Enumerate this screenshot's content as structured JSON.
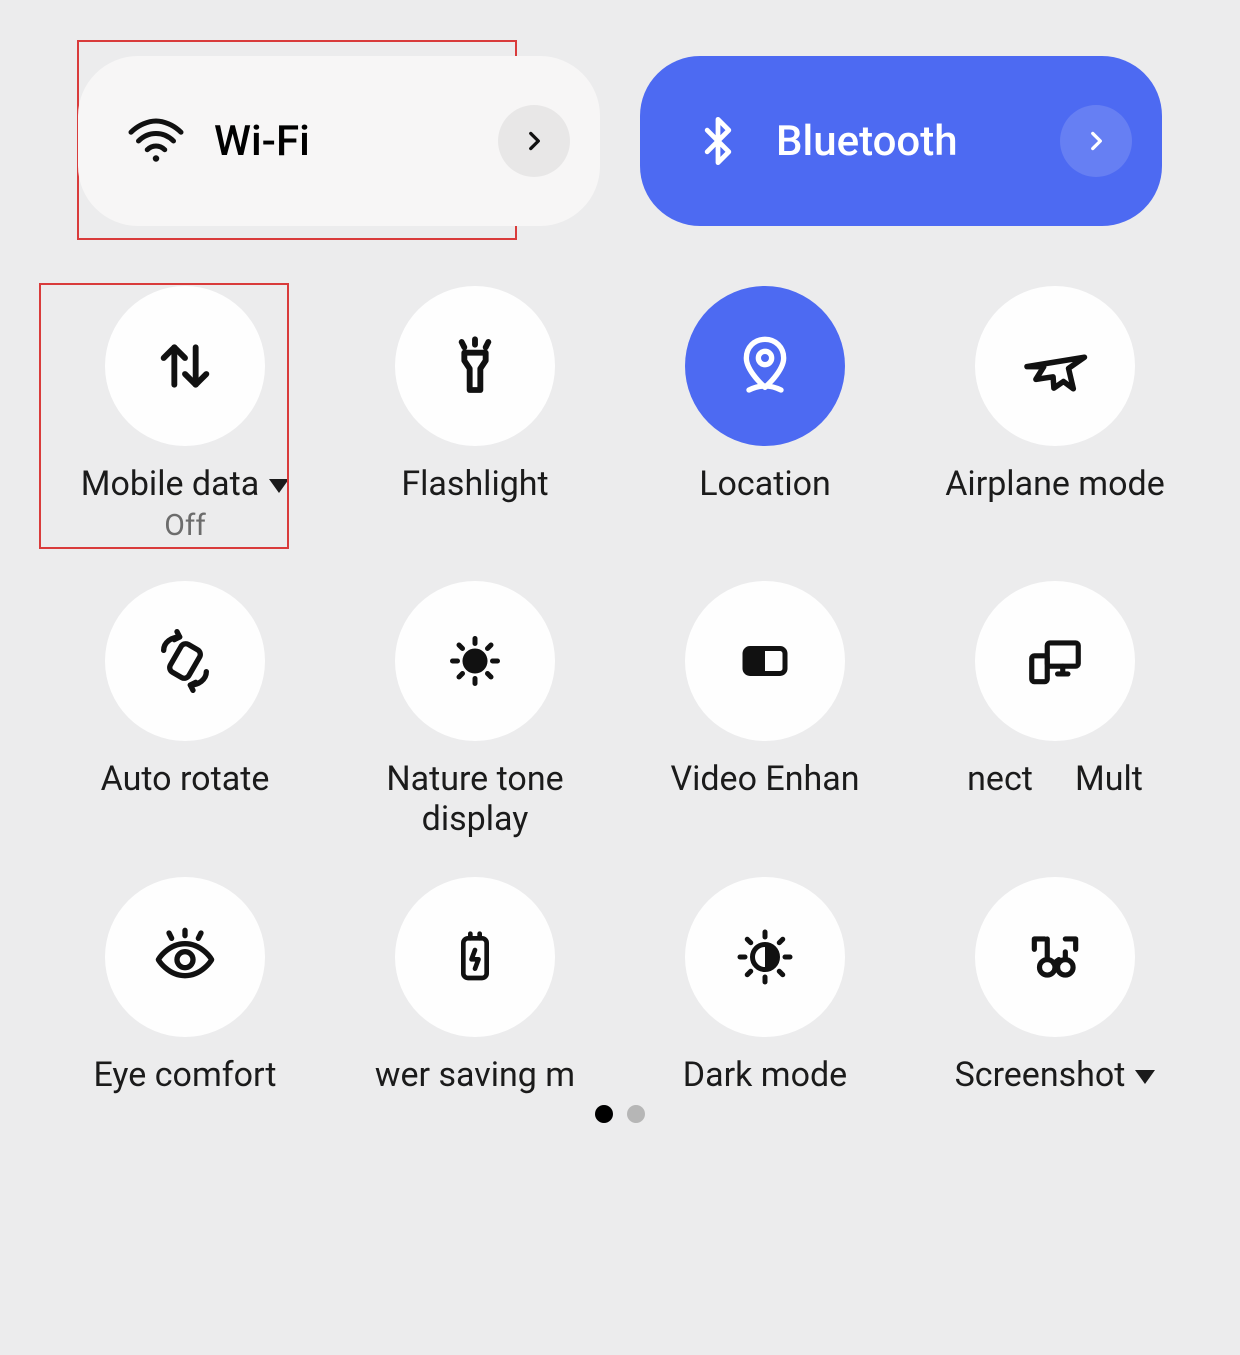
{
  "colors": {
    "accent": "#4d6af2",
    "highlight": "#d93b3b"
  },
  "top": {
    "wifi": {
      "label": "Wi-Fi",
      "active": false
    },
    "bluetooth": {
      "label": "Bluetooth",
      "active": true
    }
  },
  "tiles": [
    {
      "id": "mobile-data",
      "label": "Mobile data",
      "sub": "Off",
      "active": false,
      "dropdown": true,
      "highlight": true
    },
    {
      "id": "flashlight",
      "label": "Flashlight",
      "active": false
    },
    {
      "id": "location",
      "label": "Location",
      "active": true
    },
    {
      "id": "airplane",
      "label": "Airplane mode",
      "active": false
    },
    {
      "id": "autorotate",
      "label": "Auto rotate",
      "active": false
    },
    {
      "id": "naturetone",
      "label": "Nature tone display",
      "active": false
    },
    {
      "id": "videoenh",
      "label": "Video Enhan",
      "active": false,
      "nowrap": true
    },
    {
      "id": "multi",
      "label": "nect     Mult",
      "active": false,
      "nowrap": true
    },
    {
      "id": "eyecomfort",
      "label": "Eye comfort",
      "active": false
    },
    {
      "id": "powersave",
      "label": "wer saving m",
      "active": false,
      "nowrap": true
    },
    {
      "id": "darkmode",
      "label": "Dark mode",
      "active": false
    },
    {
      "id": "screenshot",
      "label": "Screenshot",
      "active": false,
      "dropdown": true
    }
  ],
  "pager": {
    "current": 0,
    "total": 2
  }
}
